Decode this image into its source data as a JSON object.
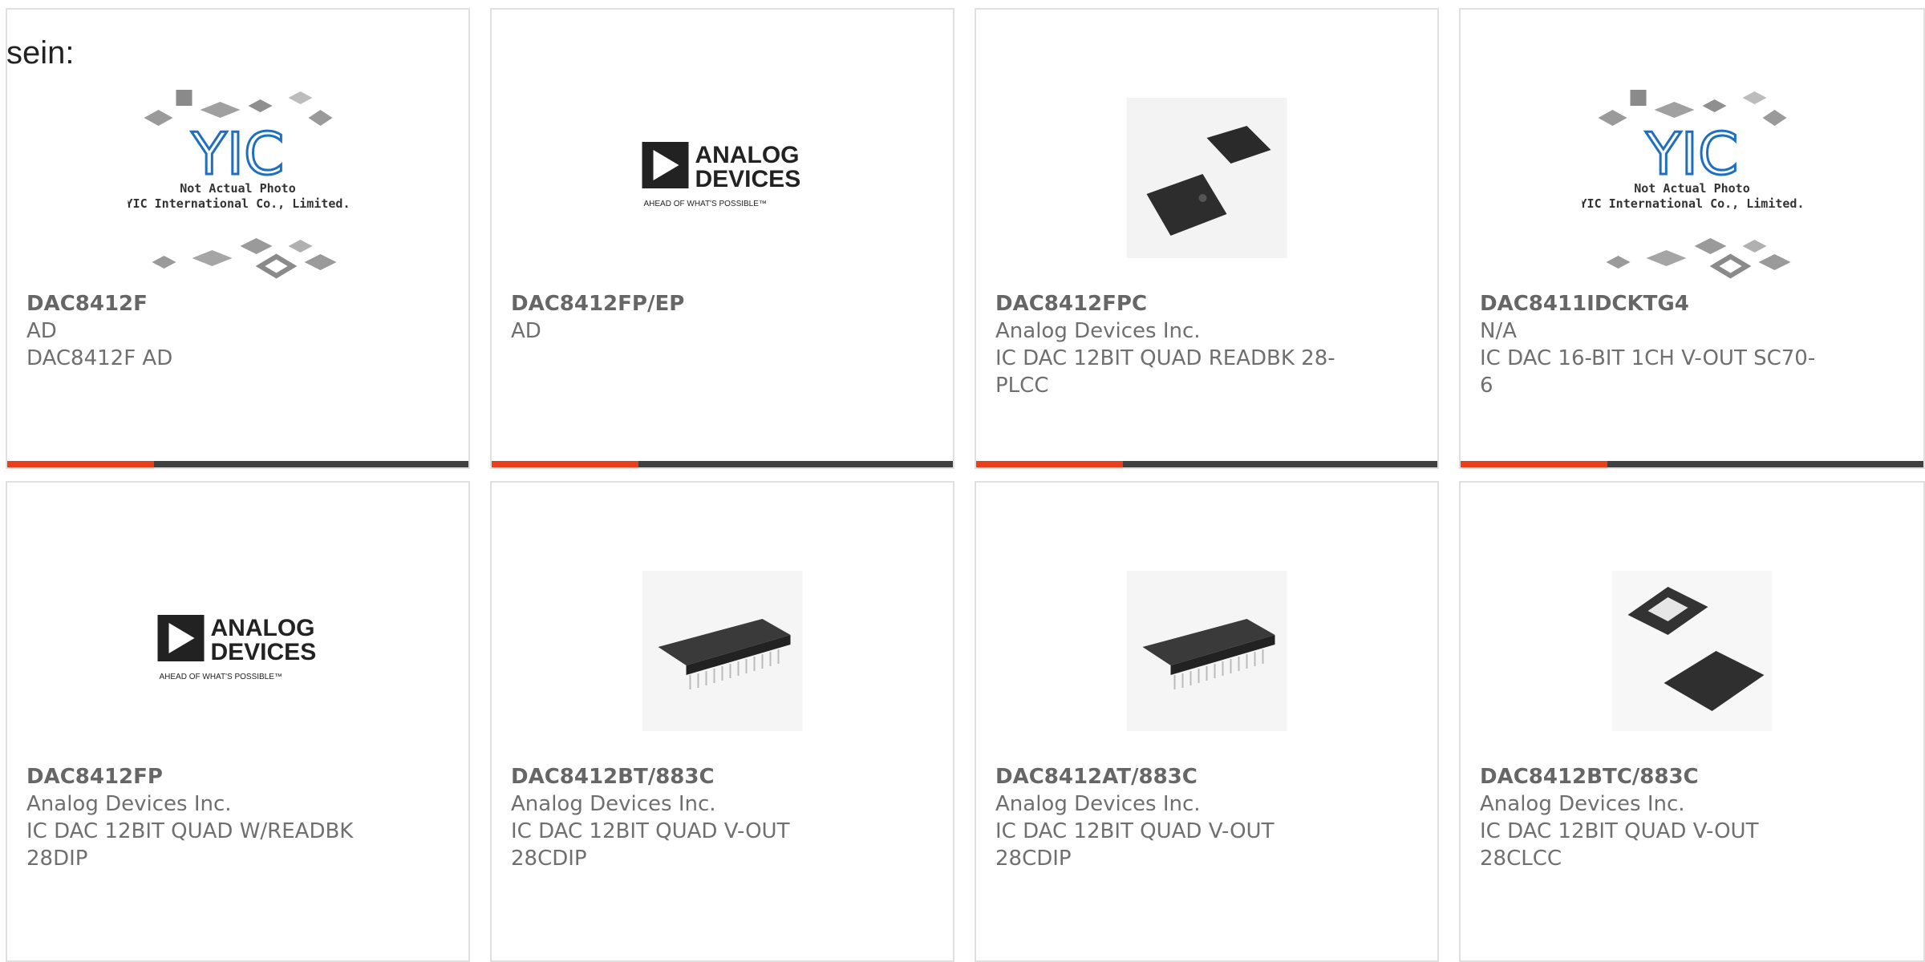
{
  "intro_text": "sein:",
  "placeholder_text": {
    "line1": "Not Actual Photo",
    "line2": "YIC International Co., Limited."
  },
  "brand_logo": {
    "line1": "ANALOG",
    "line2": "DEVICES",
    "tagline": "AHEAD OF WHAT'S POSSIBLE™"
  },
  "colors": {
    "accent": "#e8401c",
    "bar_dark": "#404040",
    "text_gray": "#6f6f6f",
    "border": "#e0e0e0",
    "yic_blue": "#1f6fc0"
  },
  "products": [
    {
      "part": "DAC8412F",
      "manufacturer": "AD",
      "desc1": "DAC8412F AD",
      "desc2": "",
      "image": "yic-placeholder"
    },
    {
      "part": "DAC8412FP/EP",
      "manufacturer": "AD",
      "desc1": "",
      "desc2": "",
      "image": "analog-devices-logo"
    },
    {
      "part": "DAC8412FPC",
      "manufacturer": "Analog Devices Inc.",
      "desc1": "IC DAC 12BIT QUAD READBK 28-",
      "desc2": "PLCC",
      "image": "plcc-chips"
    },
    {
      "part": "DAC8411IDCKTG4",
      "manufacturer": "N/A",
      "desc1": "IC DAC 16-BIT 1CH V-OUT SC70-",
      "desc2": "6",
      "image": "yic-placeholder"
    },
    {
      "part": "DAC8412FP",
      "manufacturer": "Analog Devices Inc.",
      "desc1": "IC DAC 12BIT QUAD W/READBK",
      "desc2": "28DIP",
      "image": "analog-devices-logo"
    },
    {
      "part": "DAC8412BT/883C",
      "manufacturer": "Analog Devices Inc.",
      "desc1": "IC DAC 12BIT QUAD V-OUT",
      "desc2": "28CDIP",
      "image": "dip-chip"
    },
    {
      "part": "DAC8412AT/883C",
      "manufacturer": "Analog Devices Inc.",
      "desc1": "IC DAC 12BIT QUAD V-OUT",
      "desc2": "28CDIP",
      "image": "dip-chip"
    },
    {
      "part": "DAC8412BTC/883C",
      "manufacturer": "Analog Devices Inc.",
      "desc1": "IC DAC 12BIT QUAD V-OUT",
      "desc2": "28CLCC",
      "image": "lcc-chips"
    }
  ]
}
